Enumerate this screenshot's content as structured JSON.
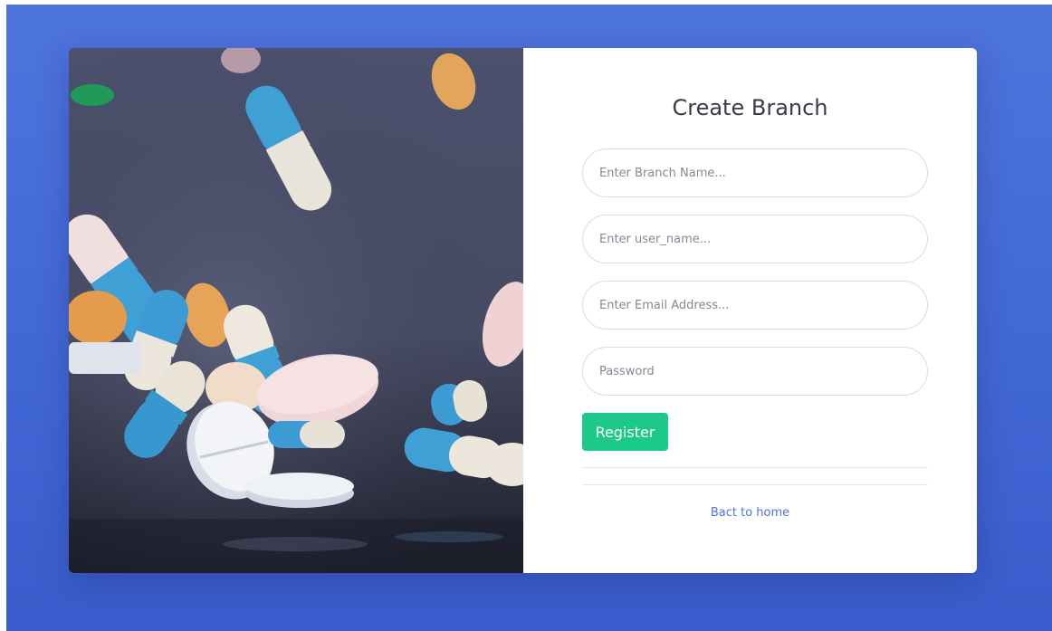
{
  "form": {
    "title": "Create Branch",
    "branch_name_placeholder": "Enter Branch Name...",
    "user_name_placeholder": "Enter user_name...",
    "email_placeholder": "Enter Email Address...",
    "password_placeholder": "Password",
    "register_label": "Register",
    "back_link": "Bact to home"
  },
  "colors": {
    "background": "#4e73df",
    "register_button": "#1cc88a",
    "link": "#4e73df"
  }
}
